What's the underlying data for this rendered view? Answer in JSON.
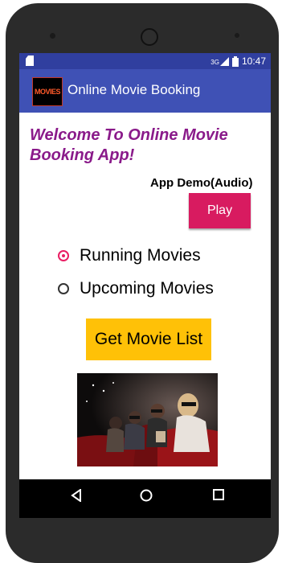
{
  "status_bar": {
    "signal": "3G",
    "time": "10:47"
  },
  "app_bar": {
    "logo_text": "MOVIES",
    "title": "Online Movie Booking"
  },
  "main": {
    "welcome": "Welcome To Online Movie Booking App!",
    "demo_label": "App Demo(Audio)",
    "play_label": "Play",
    "radio_options": [
      {
        "label": "Running Movies",
        "selected": true
      },
      {
        "label": "Upcoming Movies",
        "selected": false
      }
    ],
    "get_list_label": "Get Movie List"
  },
  "colors": {
    "status_bar": "#303f9f",
    "app_bar": "#3f51b5",
    "welcome_text": "#8a1a8a",
    "play_button": "#d81b60",
    "get_button": "#ffc107",
    "radio_accent": "#e91e63"
  },
  "icons": [
    "sd-card-icon",
    "signal-icon",
    "battery-icon",
    "back-icon",
    "home-icon",
    "recents-icon"
  ]
}
